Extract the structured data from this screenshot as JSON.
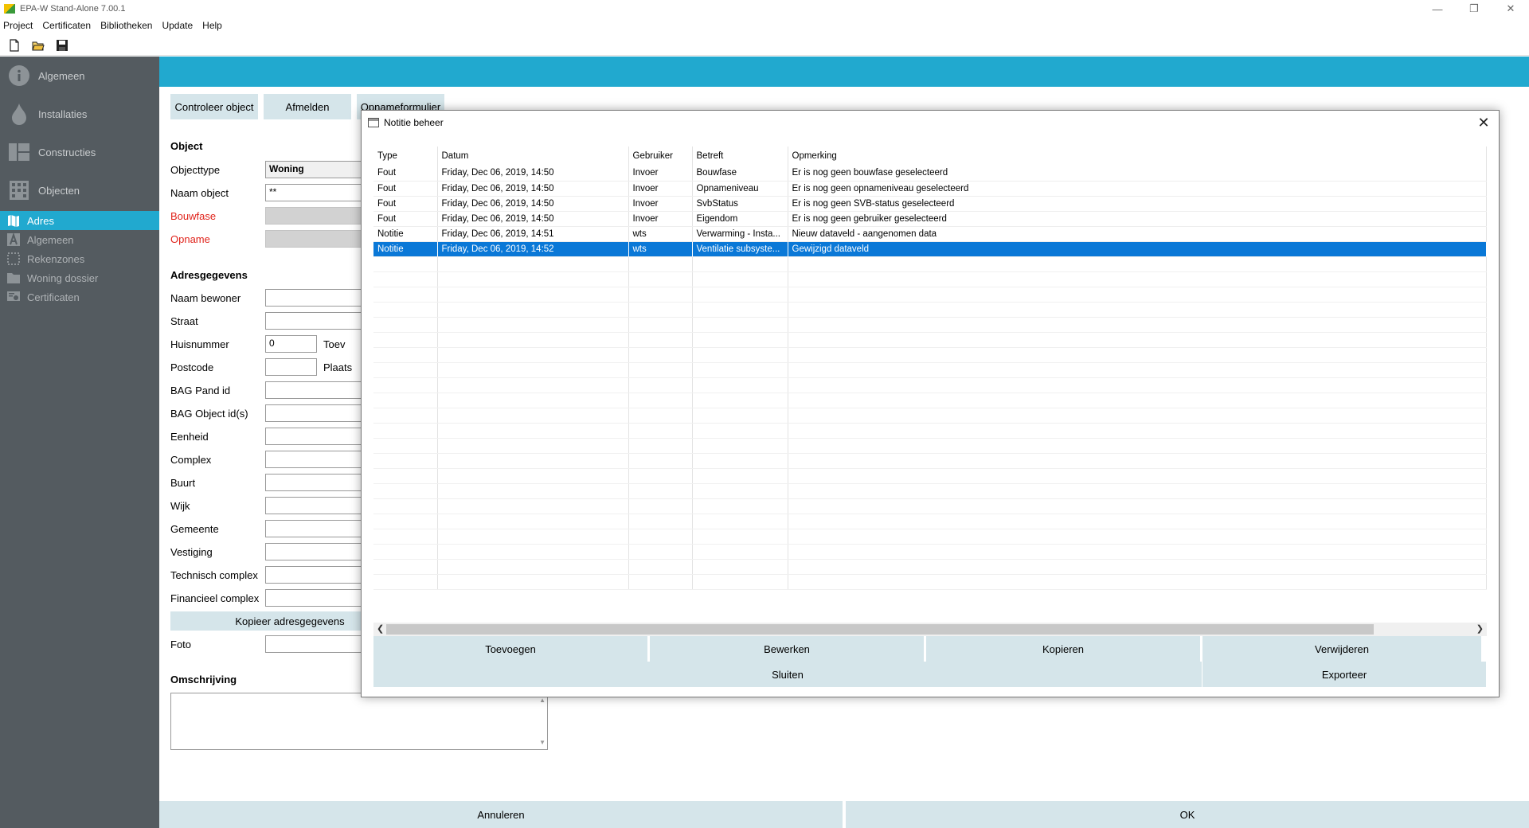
{
  "window": {
    "title": "EPA-W Stand-Alone 7.00.1"
  },
  "menu": [
    "Project",
    "Certificaten",
    "Bibliotheken",
    "Update",
    "Help"
  ],
  "sidebar": {
    "main": [
      {
        "label": "Algemeen"
      },
      {
        "label": "Installaties"
      },
      {
        "label": "Constructies"
      },
      {
        "label": "Objecten"
      }
    ],
    "sub": [
      {
        "label": "Adres"
      },
      {
        "label": "Algemeen"
      },
      {
        "label": "Rekenzones"
      },
      {
        "label": "Woning dossier"
      },
      {
        "label": "Certificaten"
      }
    ]
  },
  "main": {
    "buttons": {
      "controleer": "Controleer object",
      "afmelden": "Afmelden",
      "opname": "Opnameformulier"
    },
    "object": {
      "heading": "Object",
      "objecttype_label": "Objecttype",
      "objecttype_value": "Woning",
      "naam_label": "Naam object",
      "naam_value": "**",
      "bouwfase_label": "Bouwfase",
      "opname_label": "Opname"
    },
    "adres": {
      "heading": "Adresgegevens",
      "labels": [
        "Naam bewoner",
        "Straat",
        "Huisnummer",
        "Postcode",
        "BAG Pand id",
        "BAG Object id(s)",
        "Eenheid",
        "Complex",
        "Buurt",
        "Wijk",
        "Gemeente",
        "Vestiging",
        "Technisch complex",
        "Financieel complex"
      ],
      "huisnummer_value": "0",
      "toev_label": "Toev",
      "plaats_label": "Plaats",
      "copy_button": "Kopieer adresgegevens",
      "foto_label": "Foto"
    },
    "omschrijving_heading": "Omschrijving",
    "annuleren": "Annuleren",
    "ok": "OK"
  },
  "dialog": {
    "title": "Notitie beheer",
    "columns": [
      "Type",
      "Datum",
      "Gebruiker",
      "Betreft",
      "Opmerking"
    ],
    "rows": [
      [
        "Fout",
        "Friday, Dec 06, 2019, 14:50",
        "Invoer",
        "Bouwfase",
        "Er is nog geen bouwfase geselecteerd"
      ],
      [
        "Fout",
        "Friday, Dec 06, 2019, 14:50",
        "Invoer",
        "Opnameniveau",
        "Er is nog geen opnameniveau geselecteerd"
      ],
      [
        "Fout",
        "Friday, Dec 06, 2019, 14:50",
        "Invoer",
        "SvbStatus",
        "Er is nog geen SVB-status geselecteerd"
      ],
      [
        "Fout",
        "Friday, Dec 06, 2019, 14:50",
        "Invoer",
        "Eigendom",
        "Er is nog geen gebruiker geselecteerd"
      ],
      [
        "Notitie",
        "Friday, Dec 06, 2019, 14:51",
        "wts",
        "Verwarming - Insta...",
        "Nieuw dataveld - aangenomen data"
      ],
      [
        "Notitie",
        "Friday, Dec 06, 2019, 14:52",
        "wts",
        "Ventilatie subsyste...",
        "Gewijzigd dataveld"
      ]
    ],
    "selected_row": 5,
    "buttons": {
      "toevoegen": "Toevoegen",
      "bewerken": "Bewerken",
      "kopieren": "Kopieren",
      "verwijderen": "Verwijderen",
      "sluiten": "Sluiten",
      "exporteer": "Exporteer"
    }
  },
  "colors": {
    "accent": "#21a9cf",
    "sidebar": "#545b60",
    "button": "#d5e5ea",
    "selection": "#0a78d7",
    "required": "#e0231b"
  }
}
